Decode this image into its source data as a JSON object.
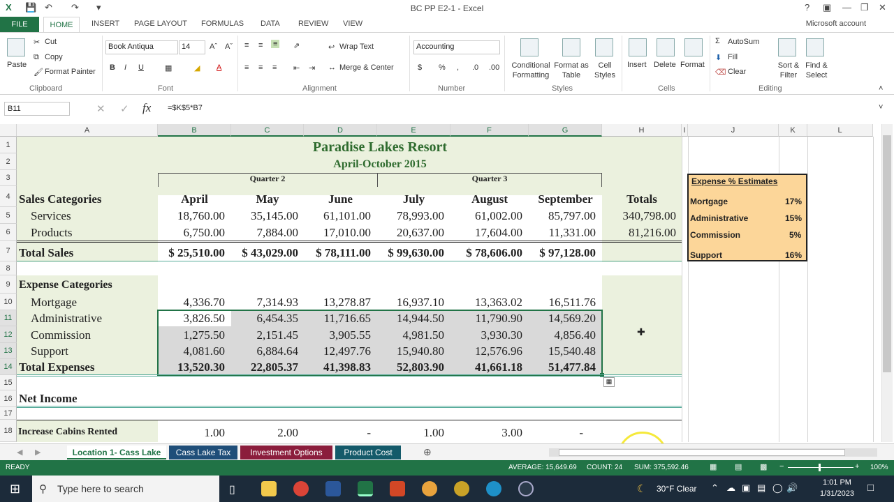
{
  "title_bar": {
    "doc_title": "BC PP E2-1 - Excel",
    "help": "?"
  },
  "ribbon_tabs": [
    "FILE",
    "HOME",
    "INSERT",
    "PAGE LAYOUT",
    "FORMULAS",
    "DATA",
    "REVIEW",
    "VIEW"
  ],
  "account": "Microsoft account",
  "ribbon": {
    "clipboard": {
      "paste": "Paste",
      "cut": "Cut",
      "copy": "Copy",
      "format_painter": "Format Painter",
      "label": "Clipboard"
    },
    "font": {
      "name": "Book Antiqua",
      "size": "14",
      "label": "Font"
    },
    "alignment": {
      "wrap": "Wrap Text",
      "merge": "Merge & Center",
      "label": "Alignment"
    },
    "number": {
      "format": "Accounting",
      "label": "Number"
    },
    "styles": {
      "conditional": "Conditional Formatting",
      "format_as_table": "Format as Table",
      "cell_styles": "Cell Styles",
      "label": "Styles"
    },
    "cells": {
      "insert": "Insert",
      "delete": "Delete",
      "format": "Format",
      "label": "Cells"
    },
    "editing": {
      "autosum": "AutoSum",
      "fill": "Fill",
      "clear": "Clear",
      "sort": "Sort & Filter",
      "find": "Find & Select",
      "label": "Editing"
    }
  },
  "formula_bar": {
    "name_box": "B11",
    "formula": "=$K$5*B7"
  },
  "columns": [
    "A",
    "B",
    "C",
    "D",
    "E",
    "F",
    "G",
    "H",
    "I",
    "J",
    "K",
    "L"
  ],
  "rows": [
    "1",
    "2",
    "3",
    "4",
    "5",
    "6",
    "7",
    "8",
    "9",
    "10",
    "11",
    "12",
    "13",
    "14",
    "15",
    "16",
    "17",
    "18"
  ],
  "sheet": {
    "title": "Paradise Lakes Resort",
    "subtitle": "April-October 2015",
    "q2": "Quarter 2",
    "q3": "Quarter 3",
    "sales_header": "Sales Categories",
    "months": [
      "April",
      "May",
      "June",
      "July",
      "August",
      "September",
      "Totals"
    ],
    "services": {
      "label": "Services",
      "values": [
        "18,760.00",
        "35,145.00",
        "61,101.00",
        "78,993.00",
        "61,002.00",
        "85,797.00",
        "340,798.00"
      ]
    },
    "products": {
      "label": "Products",
      "values": [
        "6,750.00",
        "7,884.00",
        "17,010.00",
        "20,637.00",
        "17,604.00",
        "11,331.00",
        "81,216.00"
      ]
    },
    "total_sales": {
      "label": "Total Sales",
      "values": [
        "$ 25,510.00",
        "$ 43,029.00",
        "$ 78,111.00",
        "$ 99,630.00",
        "$  78,606.00",
        "$ 97,128.00"
      ]
    },
    "expense_header": "Expense Categories",
    "mortgage": {
      "label": "Mortgage",
      "values": [
        "4,336.70",
        "7,314.93",
        "13,278.87",
        "16,937.10",
        "13,363.02",
        "16,511.76"
      ]
    },
    "administrative": {
      "label": "Administrative",
      "values": [
        "3,826.50",
        "6,454.35",
        "11,716.65",
        "14,944.50",
        "11,790.90",
        "14,569.20"
      ]
    },
    "commission": {
      "label": "Commission",
      "values": [
        "1,275.50",
        "2,151.45",
        "3,905.55",
        "4,981.50",
        "3,930.30",
        "4,856.40"
      ]
    },
    "support": {
      "label": "Support",
      "values": [
        "4,081.60",
        "6,884.64",
        "12,497.76",
        "15,940.80",
        "12,576.96",
        "15,540.48"
      ]
    },
    "total_expenses": {
      "label": "Total Expenses",
      "values": [
        "13,520.30",
        "22,805.37",
        "41,398.83",
        "52,803.90",
        "41,661.18",
        "51,477.84"
      ]
    },
    "net_income": {
      "label": "Net Income"
    },
    "cabins": {
      "label": "Increase Cabins Rented",
      "values": [
        "1.00",
        "2.00",
        "-",
        "1.00",
        "3.00",
        "-"
      ]
    }
  },
  "estimates": {
    "title": "Expense % Estimates",
    "items": [
      {
        "label": "Mortgage",
        "value": "17%"
      },
      {
        "label": "Administrative",
        "value": "15%"
      },
      {
        "label": "Commission",
        "value": "5%"
      },
      {
        "label": "Support",
        "value": "16%"
      }
    ]
  },
  "sheet_tabs": [
    "Location 1- Cass Lake",
    "Cass Lake Tax",
    "Investment Options",
    "Product Cost"
  ],
  "status": {
    "ready": "READY",
    "average": "AVERAGE: 15,649.69",
    "count": "COUNT: 24",
    "sum": "SUM: 375,592.46",
    "zoom": "100%"
  },
  "taskbar": {
    "search": "Type here to search",
    "weather": "30°F  Clear",
    "time": "1:01 PM",
    "date": "1/31/2023"
  }
}
